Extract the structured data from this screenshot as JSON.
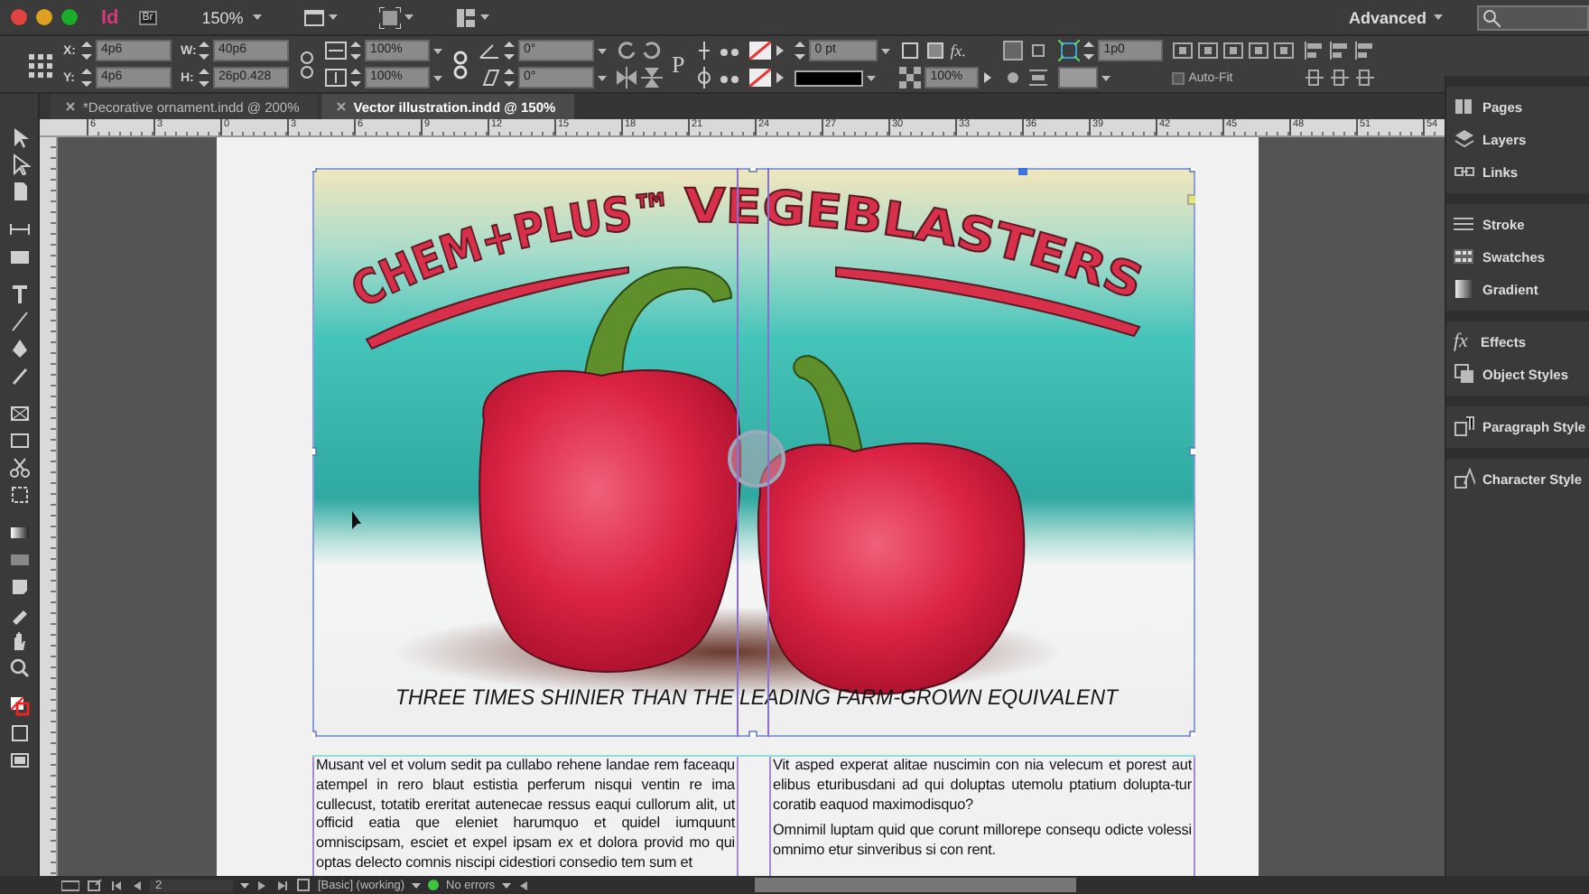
{
  "app_bar": {
    "logo": "Id",
    "bridge": "Br",
    "zoom": "150%",
    "workspace": "Advanced"
  },
  "control_panel": {
    "position": [
      {
        "label": "X:",
        "value": "4p6"
      },
      {
        "label": "Y:",
        "value": "4p6"
      }
    ],
    "size": [
      {
        "label": "W:",
        "value": "40p6"
      },
      {
        "label": "H:",
        "value": "26p0.428"
      }
    ],
    "scale": [
      "100%",
      "100%"
    ],
    "angles": [
      "0°",
      "0°"
    ],
    "type_glyph": "P",
    "stroke_weight": "0 pt",
    "effects_glyph": "fx.",
    "opacity": "100%",
    "offset": "1p0",
    "auto_fit": {
      "label": "Auto-Fit",
      "checked": false
    }
  },
  "tabs": [
    {
      "label": "*Decorative ornament.indd @ 200%",
      "selected": false
    },
    {
      "label": "Vector illustration.indd @ 150%",
      "selected": true
    }
  ],
  "ruler": [
    "6",
    "3",
    "0",
    "3",
    "6",
    "9",
    "12",
    "15",
    "18",
    "21",
    "24",
    "27",
    "30",
    "33",
    "36",
    "39",
    "42",
    "45",
    "48",
    "51",
    "54"
  ],
  "illustration": {
    "title_words": [
      "CHEM+PLUS™",
      "VEGEBLASTERS"
    ],
    "tagline": "THREE TIMES SHINIER THAN THE LEADING FARM-GROWN EQUIVALENT"
  },
  "columns": [
    [
      "Musant vel et volum sedit pa cullabo rehene landae rem faceaqu atempel in rero blaut estistia perferum nisqui ventin re ima cullecust, totatib ereritat autenecae ressus eaqui cullorum alit, ut officid eatia que eleniet harumquo et quidel iumquunt omniscipsam, esciet et expel ipsam ex et dolora provid mo qui optas delecto comnis niscipi cidestiori consedio tem sum et"
    ],
    [
      "Vit asped experat alitae nuscimin con nia velecum et porest aut elibus eturibusdani ad qui doluptas utemolu ptatium dolupta-tur coratib eaquod maximodisquo?",
      "Omnimil luptam quid que corunt millorepe consequ odicte volessi omnimo etur sinveribus si con rent."
    ]
  ],
  "dock": [
    [
      {
        "kind": "pages",
        "label": "Pages"
      },
      {
        "kind": "layers",
        "label": "Layers"
      },
      {
        "kind": "links",
        "label": "Links"
      }
    ],
    [
      {
        "kind": "stroke",
        "label": "Stroke"
      },
      {
        "kind": "swatches",
        "label": "Swatches"
      },
      {
        "kind": "gradient",
        "label": "Gradient"
      }
    ],
    [
      {
        "kind": "effects",
        "label": "Effects",
        "glyph": "fx"
      },
      {
        "kind": "object_styles",
        "label": "Object Styles"
      }
    ],
    [
      {
        "kind": "paragraph_styles",
        "label": "Paragraph Style"
      }
    ],
    [
      {
        "kind": "character_styles",
        "label": "Character Style"
      }
    ]
  ],
  "status_bar": {
    "page": "2",
    "profile": "[Basic] (working)",
    "preflight": "No errors"
  }
}
